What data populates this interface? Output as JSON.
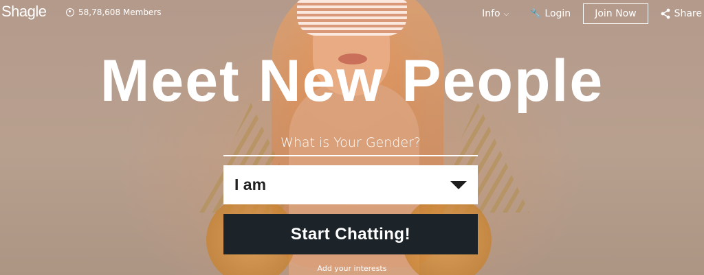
{
  "brand": {
    "logo": "Shagle"
  },
  "header": {
    "members": "58,78,608 Members",
    "nav": {
      "info": "Info",
      "login": "Login",
      "join": "Join Now",
      "share": "Share"
    }
  },
  "hero": {
    "headline": "Meet New People",
    "gender_prompt": "What is Your Gender?",
    "select_value": "I am",
    "start_button": "Start Chatting!",
    "interests_link": "Add your interests"
  },
  "colors": {
    "button_bg": "#1c2329",
    "overlay": "#b89a88",
    "text": "#ffffff"
  },
  "icons": [
    "user-circle-icon",
    "chevron-down-icon",
    "key-icon",
    "share-icon",
    "dropdown-arrow-icon"
  ]
}
